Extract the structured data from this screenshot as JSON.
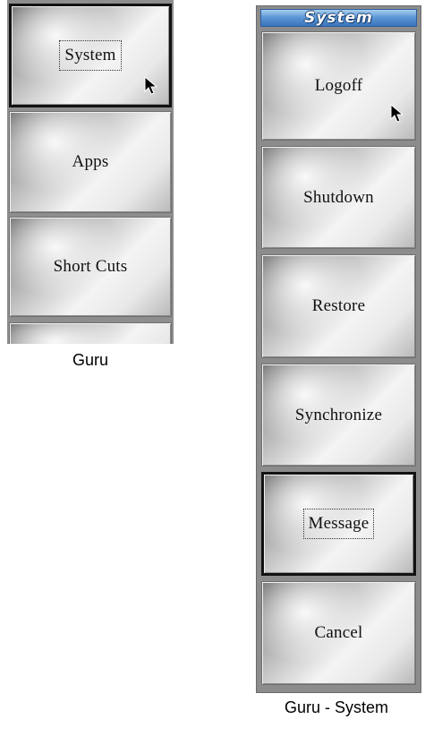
{
  "guru": {
    "caption": "Guru",
    "buttons": [
      {
        "label": "System"
      },
      {
        "label": "Apps"
      },
      {
        "label": "Short Cuts"
      },
      {
        "label": ""
      }
    ]
  },
  "guru_system": {
    "caption": "Guru - System",
    "title": "System",
    "buttons": [
      {
        "label": "Logoff"
      },
      {
        "label": "Shutdown"
      },
      {
        "label": "Restore"
      },
      {
        "label": "Synchronize"
      },
      {
        "label": "Message"
      },
      {
        "label": "Cancel"
      }
    ]
  },
  "colors": {
    "title_bar": "#5e98d6",
    "button_face": "#e9e9e9",
    "panel_bg": "#8c8c8c"
  }
}
